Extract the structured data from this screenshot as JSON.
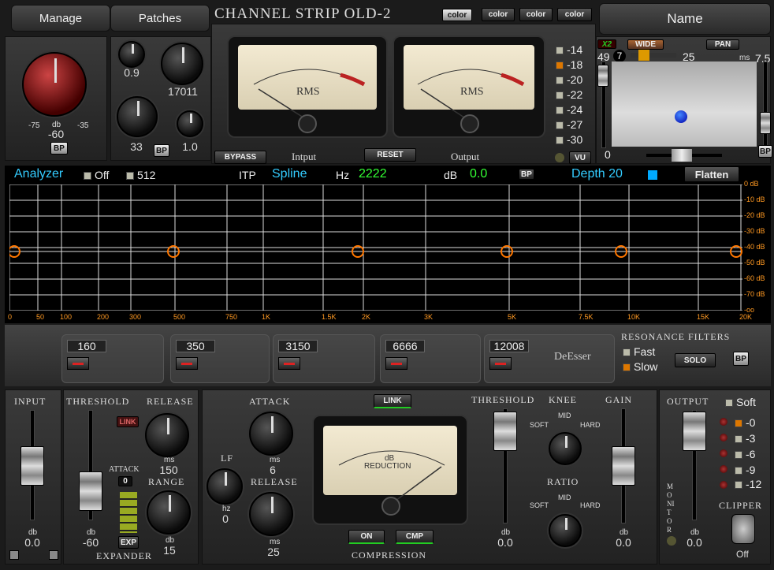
{
  "header": {
    "manage": "Manage",
    "patches": "Patches",
    "title": "CHANNEL STRIP OLD-2",
    "color_buttons": [
      "color",
      "color",
      "color",
      "color"
    ],
    "name": "Name"
  },
  "input_section": {
    "big_knob_value": "-60",
    "big_knob_unit": "db",
    "big_knob_min": "-75",
    "big_knob_max": "-35",
    "bp": "BP",
    "k1": "0.9",
    "k2": "17011",
    "k3": "33",
    "k4": "1.0",
    "bp2": "BP"
  },
  "meters": {
    "bypass": "BYPASS",
    "input_label": "Intput",
    "reset": "RESET",
    "output_label": "Output",
    "vu": "VU",
    "rms": "RMS",
    "scale_left": [
      "-20",
      "-10",
      "-7",
      "-5",
      "-3",
      "-2",
      "-1",
      "0",
      "1",
      "2",
      "3"
    ],
    "levels": [
      "-14",
      "-18",
      "-20",
      "-22",
      "-24",
      "-27",
      "-30"
    ]
  },
  "pan": {
    "x2": "X2",
    "wide": "WIDE",
    "pan": "PAN",
    "v49": "49",
    "v7": "7",
    "v25": "25",
    "ms": "ms",
    "v75": "7.5",
    "v0": "0",
    "bp": "BP"
  },
  "analyzer": {
    "title": "Analyzer",
    "off": "Off",
    "res": "512",
    "itp": "ITP",
    "spline": "Spline",
    "hz_label": "Hz",
    "hz": "2222",
    "db_label": "dB",
    "db": "0.0",
    "bp": "BP",
    "depth": "Depth",
    "depth_val": "20",
    "flatten": "Flatten",
    "db_ticks": [
      "0 dB",
      "-10 dB",
      "-20 dB",
      "-30 dB",
      "-40 dB",
      "-50 dB",
      "-60 dB",
      "-70 dB",
      "-oo"
    ],
    "freq_ticks": [
      "0",
      "50",
      "100",
      "200",
      "300",
      "500",
      "750",
      "1K",
      "1.5K",
      "2K",
      "3K",
      "5K",
      "7.5K",
      "10K",
      "15K",
      "20K"
    ]
  },
  "bands": {
    "values": [
      "160",
      "350",
      "3150",
      "6666",
      "12008"
    ],
    "deesser": "DeEsser",
    "resonance": "RESONANCE FILTERS",
    "fast": "Fast",
    "slow": "Slow",
    "solo": "SOLO",
    "bp": "BP"
  },
  "bottom": {
    "input": "INPUT",
    "input_db": "db",
    "input_val": "0.0",
    "threshold": "THRESHOLD",
    "release": "RELEASE",
    "link": "LINK",
    "release_ms": "ms",
    "release_val": "150",
    "attack": "ATTACK",
    "attack_val": "0",
    "range": "RANGE",
    "range_db": "db",
    "range_val": "15",
    "th_db": "db",
    "th_val": "-60",
    "exp": "EXP",
    "expander": "EXPANDER",
    "c_attack": "ATTACK",
    "c_attack_ms": "ms",
    "c_attack_val": "6",
    "lf": "LF",
    "lf_hz": "hz",
    "lf_val": "0",
    "c_release": "RELEASE",
    "c_release_ms": "ms",
    "c_release_val": "25",
    "c_link": "LINK",
    "on": "ON",
    "cmp": "CMP",
    "compression": "COMPRESSION",
    "gr_db": "dB",
    "gr": "REDUCTION",
    "threshold2": "THRESHOLD",
    "knee": "KNEE",
    "soft": "SOFT",
    "mid": "MID",
    "hard": "HARD",
    "ratio": "RATIO",
    "soft2": "SOFT",
    "mid2": "MID",
    "hard2": "HARD",
    "th2_db": "db",
    "th2_val": "0.0",
    "gain": "GAIN",
    "gain_db": "db",
    "gain_val": "0.0",
    "output": "OUTPUT",
    "softclip": "Soft",
    "out_levels": [
      "-0",
      "-3",
      "-6",
      "-9",
      "-12"
    ],
    "monitor": "MONITOR",
    "out_db": "db",
    "out_val": "0.0",
    "clipper": "CLIPPER",
    "clipper_state": "Off"
  }
}
